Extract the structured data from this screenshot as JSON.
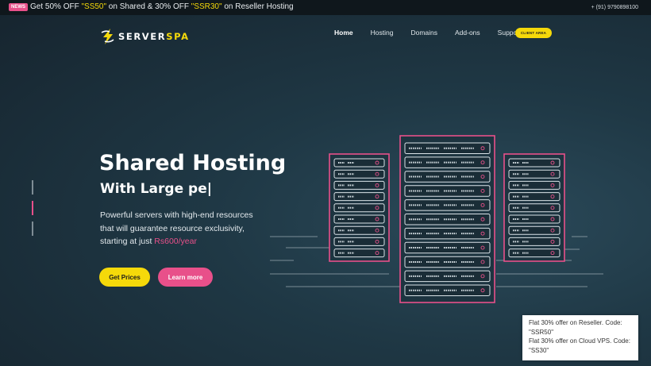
{
  "topbar": {
    "badge": "NEWS",
    "promo_prefix": "Get 50% OFF ",
    "code1": "\"SS50\"",
    "promo_mid": " on Shared & 30% OFF ",
    "code2": "\"SSR30\"",
    "promo_suffix": " on Reseller Hosting",
    "phone": "+ (91) 9790898100"
  },
  "logo": {
    "part1": "SERVER",
    "part2": "SPA"
  },
  "nav": {
    "items": [
      "Home",
      "Hosting",
      "Domains",
      "Add-ons",
      "Support"
    ],
    "client_area": "CLIENT AREA"
  },
  "hero": {
    "title": "Shared Hosting",
    "subtitle": "With Large pe|",
    "desc_line1": "Powerful servers with high-end resources",
    "desc_line2": "that will guarantee resource exclusivity,",
    "desc_line3": "starting at just ",
    "price": "Rs600/year",
    "btn_prices": "Get Prices",
    "btn_learn": "Learn more"
  },
  "toast": {
    "line1": "Flat 30% offer on Reseller. Code:",
    "line2": "\"SSR50\"",
    "line3": "Flat 30% offer on Cloud VPS. Code:",
    "line4": "\"SS30\""
  },
  "colors": {
    "accent_yellow": "#f5d90a",
    "accent_pink": "#e8508a",
    "server_stroke": "#e8508a"
  }
}
